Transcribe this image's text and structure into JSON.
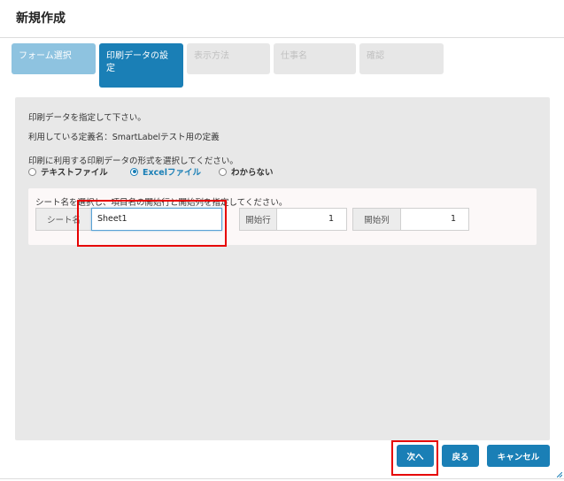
{
  "dialog": {
    "title": "新規作成"
  },
  "steps": [
    {
      "label": "フォーム選択",
      "state": "done"
    },
    {
      "label": "印刷データの設定",
      "state": "active"
    },
    {
      "label": "表示方法",
      "state": "todo"
    },
    {
      "label": "仕事名",
      "state": "todo"
    },
    {
      "label": "確認",
      "state": "todo"
    }
  ],
  "panel": {
    "instruction": "印刷データを指定して下さい。",
    "definition_text": "利用している定義名：SmartLabelテスト用の定義",
    "format_prompt": "印刷に利用する印刷データの形式を選択してください。",
    "formats": [
      {
        "label": "テキストファイル",
        "checked": false
      },
      {
        "label": "Excelファイル",
        "checked": true
      },
      {
        "label": "わからない",
        "checked": false
      }
    ],
    "sheet_prompt": "シート名を選択し、項目名の開始行と開始列を指定してください。",
    "sheet_label": "シート名",
    "sheet_value": "Sheet1",
    "start_row_label": "開始行",
    "start_row_value": "1",
    "start_col_label": "開始列",
    "start_col_value": "1"
  },
  "footer": {
    "next_label": "次へ",
    "back_label": "戻る",
    "cancel_label": "キャンセル"
  },
  "colors": {
    "primary": "#1a7fb6",
    "step_done": "#8ec3e0",
    "step_todo": "#e7e7e7",
    "highlight": "#e60000"
  }
}
